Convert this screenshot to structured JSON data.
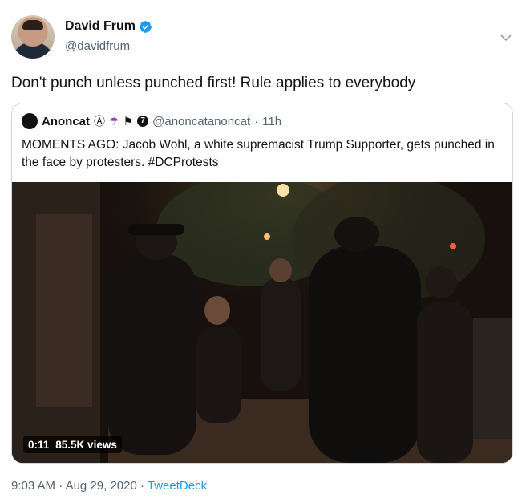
{
  "author": {
    "name": "David Frum",
    "handle": "@davidfrum",
    "verified": true,
    "avatar_icon": "profile-photo"
  },
  "tweet": {
    "text": "Don't punch unless punched first! Rule applies to everybody"
  },
  "quoted": {
    "name": "Anoncat",
    "emoji": [
      "Ⓐ",
      "☂",
      "⚑"
    ],
    "badge": "7",
    "handle": "@anoncatanoncat",
    "separator": "·",
    "time": "11h",
    "text": "MOMENTS AGO: Jacob Wohl, a white supremacist Trump Supporter, gets punched in the face by protesters. #DCProtests",
    "video": {
      "duration": "0:11",
      "views": "85.5K views"
    }
  },
  "meta": {
    "time": "9:03 AM",
    "sep1": "·",
    "date": "Aug 29, 2020",
    "sep2": "·",
    "source": "TweetDeck"
  },
  "colors": {
    "accent": "#1d9bf0",
    "secondary_text": "#536471",
    "border": "#cfd9de"
  }
}
